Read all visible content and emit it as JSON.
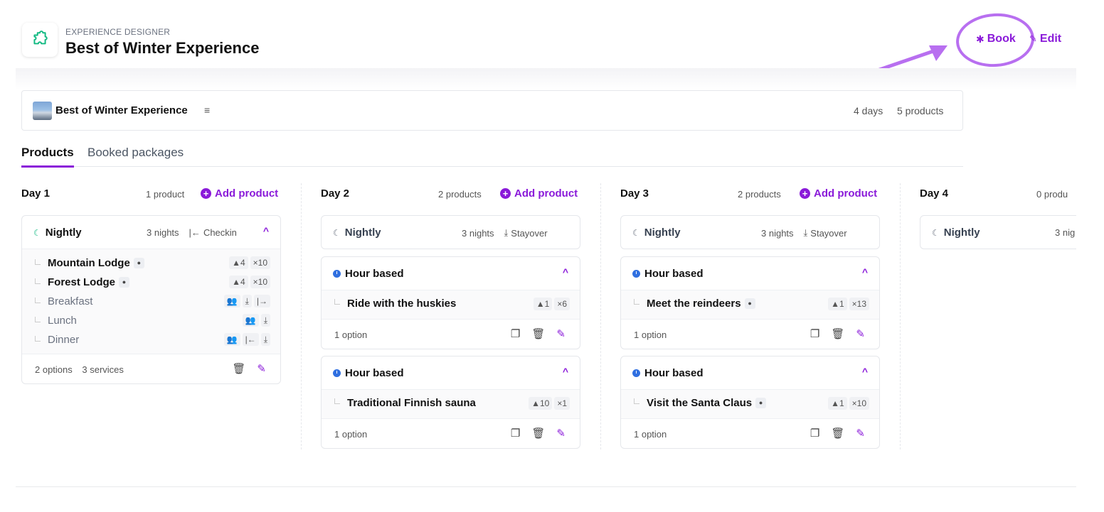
{
  "header": {
    "eyebrow": "EXPERIENCE DESIGNER",
    "title": "Best of Winter Experience",
    "book_label": "Book",
    "edit_label": "Edit",
    "accent": "#8a1ad9"
  },
  "package": {
    "name": "Best of Winter Experience",
    "days": "4 days",
    "products": "5 products"
  },
  "tabs": [
    {
      "label": "Products",
      "active": true
    },
    {
      "label": "Booked packages",
      "active": false
    }
  ],
  "days": [
    {
      "title": "Day 1",
      "count": "1 product",
      "add_label": "Add product",
      "nightly": {
        "label": "Nightly",
        "nights": "3 nights",
        "mode": "Checkin",
        "items": [
          {
            "name": "Mountain Lodge",
            "chips": [
              "4",
              "×10"
            ]
          },
          {
            "name": "Forest Lodge",
            "chips": [
              "4",
              "×10"
            ]
          },
          {
            "name": "Breakfast"
          },
          {
            "name": "Lunch"
          },
          {
            "name": "Dinner"
          }
        ],
        "options": "2 options",
        "services": "3 services"
      }
    },
    {
      "title": "Day 2",
      "count": "2 products",
      "add_label": "Add product",
      "nightly": {
        "label": "Nightly",
        "nights": "3 nights",
        "mode": "Stayover"
      },
      "hour_cards": [
        {
          "label": "Hour based",
          "item": "Ride with the huskies",
          "chips": [
            "1",
            "×6"
          ],
          "options": "1 option"
        },
        {
          "label": "Hour based",
          "item": "Traditional Finnish sauna",
          "chips": [
            "10",
            "×1"
          ],
          "options": "1 option"
        }
      ]
    },
    {
      "title": "Day 3",
      "count": "2 products",
      "add_label": "Add product",
      "nightly": {
        "label": "Nightly",
        "nights": "3 nights",
        "mode": "Stayover"
      },
      "hour_cards": [
        {
          "label": "Hour based",
          "item": "Meet the reindeers",
          "chips": [
            "1",
            "×13"
          ],
          "options": "1 option"
        },
        {
          "label": "Hour based",
          "item": "Visit the Santa Claus",
          "chips": [
            "1",
            "×10"
          ],
          "options": "1 option"
        }
      ]
    },
    {
      "title": "Day 4",
      "count": "0 produ",
      "nightly": {
        "label": "Nightly",
        "nights": "3 nig"
      }
    }
  ]
}
